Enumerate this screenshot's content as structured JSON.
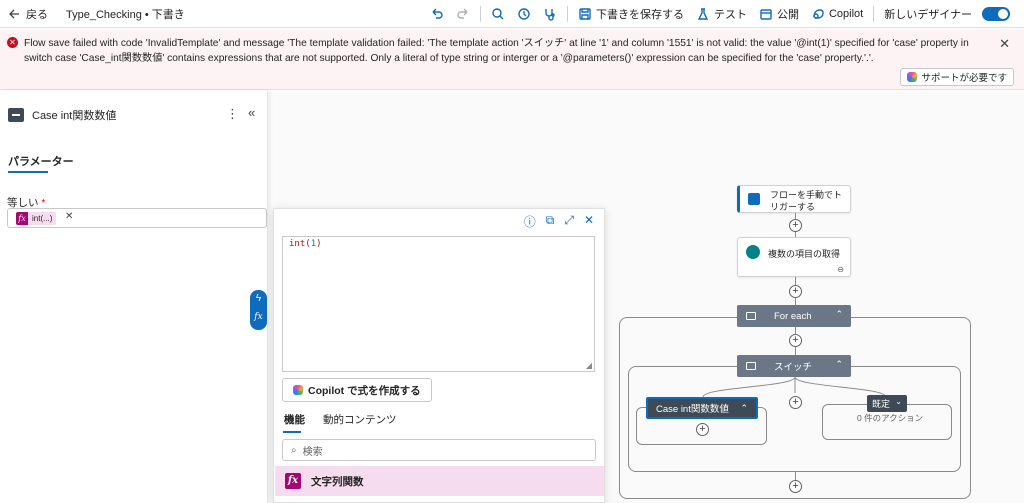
{
  "topbar": {
    "back_label": "戻る",
    "flow_name": "Type_Checking • 下書き",
    "save_draft": "下書きを保存する",
    "test": "テスト",
    "publish": "公開",
    "copilot": "Copilot",
    "new_designer": "新しいデザイナー",
    "new_designer_enabled": true
  },
  "banner": {
    "message": "Flow save failed with code 'InvalidTemplate' and message 'The template validation failed: 'The template action 'スイッチ' at line '1' and column '1551' is not valid: the value '@int(1)' specified for 'case' property in switch case 'Case_int関数数値' contains expressions that are not supported. Only a literal of type string or interger or a '@parameters()' expression can be specified for the 'case' property.'.'.",
    "support_button": "サポートが必要です",
    "accent_color": "#c50f1f"
  },
  "left_panel": {
    "title": "Case int関数数値",
    "tab": "パラメーター",
    "field_label": "等しい",
    "required_mark": "*",
    "chip_text": "int(...)",
    "chip_icon": "fx"
  },
  "expression_editor": {
    "code_fn": "int(",
    "code_num": "1",
    "code_close": ")",
    "copilot_button": "Copilot で式を作成する",
    "tabs": [
      "機能",
      "動的コンテンツ"
    ],
    "search_placeholder": "検索",
    "category": "文字列関数"
  },
  "flow": {
    "trigger": "フローを手動でトリガーする",
    "get_items": "複数の項目の取得",
    "foreach": "For each",
    "switch": "スイッチ",
    "case": "Case int関数数値",
    "default": "既定",
    "default_actions": "0 件のアクション"
  },
  "colors": {
    "brand": "#0f6cbd",
    "node_header": "#6b7787",
    "function_pink": "#a4076f"
  }
}
